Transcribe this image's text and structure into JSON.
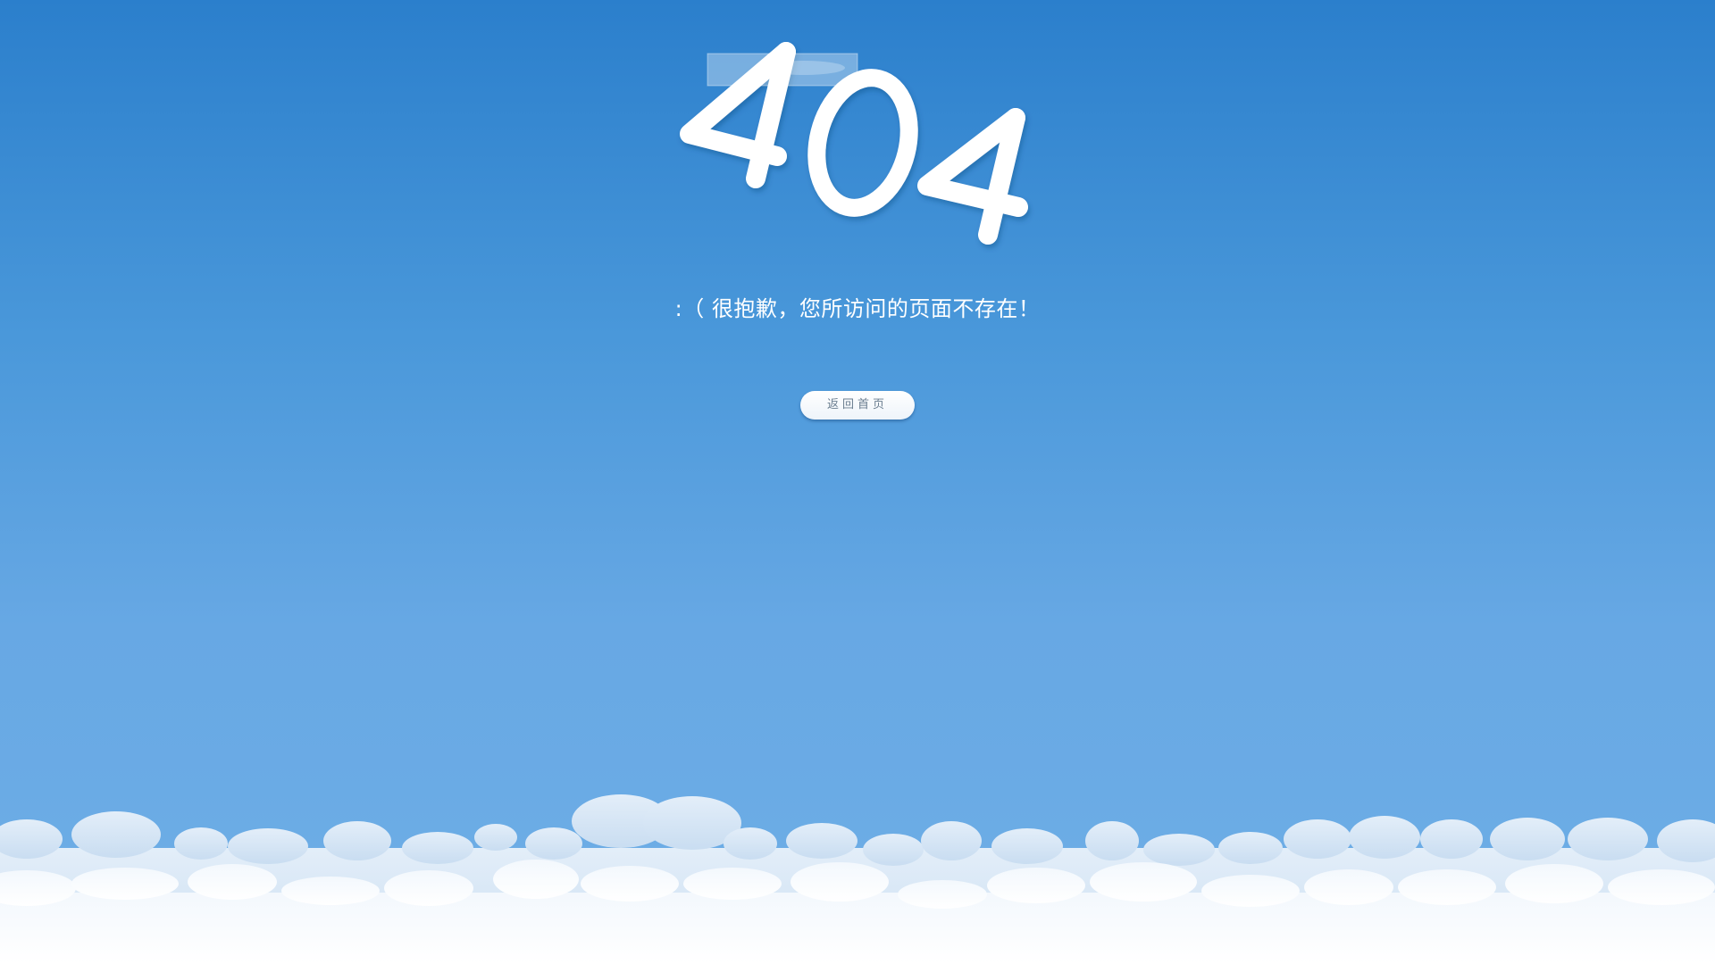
{
  "page": {
    "logo_text": "404",
    "message": ":（ 很抱歉，您所访问的页面不存在！",
    "home_button_label": "返回首页"
  },
  "colors": {
    "sky_top": "#2b7fcc",
    "sky_bottom": "#6eaee6",
    "cloud": "#ffffff",
    "text": "#ffffff",
    "button_text": "#6a7d8f"
  },
  "icons": {
    "tape": "tape-icon",
    "clouds": "clouds-illustration"
  }
}
